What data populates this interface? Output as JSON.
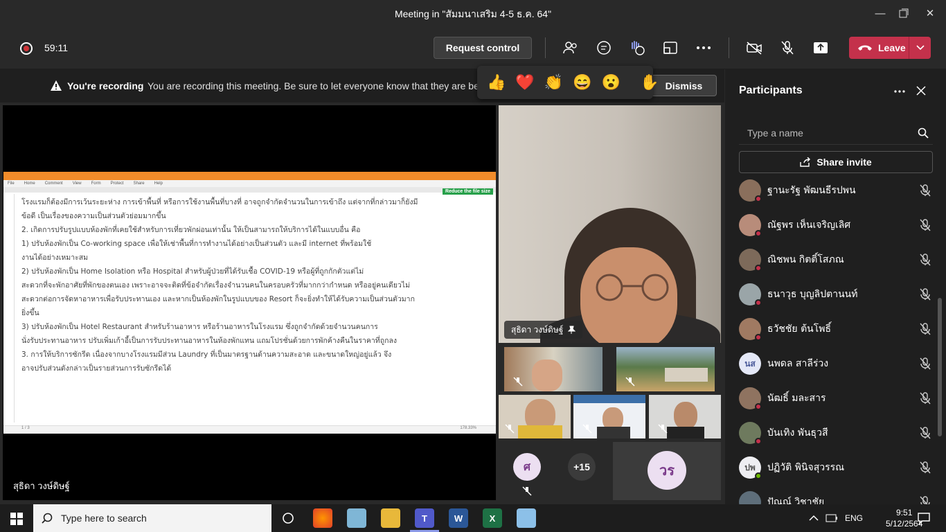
{
  "window": {
    "title": "Meeting in \"สัมมนาเสริม 4-5 ธ.ค. 64\""
  },
  "toolbar": {
    "timer": "59:11",
    "request_control": "Request control",
    "leave": "Leave"
  },
  "banner": {
    "bold": "You're recording",
    "message": "You are recording this meeting. Be sure to let everyone know that they are be",
    "dismiss": "Dismiss"
  },
  "reactions": [
    "👍",
    "❤️",
    "👏",
    "😄",
    "😮",
    "✋"
  ],
  "stage": {
    "presenter_name": "สุธิดา วงษ์ดิษฐ์",
    "document": {
      "menu": [
        "File",
        "Home",
        "Comment",
        "View",
        "Form",
        "Protect",
        "Share",
        "Help"
      ],
      "reduce_label": "Reduce the file size",
      "lines": [
        "โรงแรมก็ต้องมีการเว้นระยะห่าง การเข้าพื้นที่ หรือการใช้งานพื้นที่บางที่ อาจถูกจำกัดจำนวนในการเข้าถึง แต่จากที่กล่าวมาก็ยังมี",
        "ข้อดี เป็นเรื่องของความเป็นส่วนตัวย่อมมากขึ้น",
        "        2.  เกิดการปรับรูปแบบห้องพักที่เคยใช้สำหรับการเที่ยวพักผ่อนเท่านั้น ให้เป็นสามารถให้บริการได้ในแบบอื่น คือ",
        "              1) ปรับห้องพักเป็น Co-working space เพื่อให้เช่าพื้นที่การทำงานได้อย่างเป็นส่วนตัว และมี internet ที่พร้อมใช้",
        "งานได้อย่างเหมาะสม",
        "              2) ปรับห้องพักเป็น Home Isolation หรือ Hospital สำหรับผู้ป่วยที่ได้รับเชื้อ COVID-19 หรือผู้ที่ถูกกักตัวแต่ไม่",
        "สะดวกที่จะพักอาศัยที่พักของตนเอง เพราะอาจจะติดที่ข้อจำกัดเรื่องจำนวนคนในครอบครัวที่มากกว่ากำหนด หรืออยู่คนเดียวไม่",
        "สะดวกต่อการจัดหาอาหารเพื่อรับประทานเอง และหากเป็นห้องพักในรูปแบบของ Resort ก็จะยิ่งทำให้ได้รับความเป็นส่วนตัวมาก",
        "ยิ่งขึ้น",
        "              3) ปรับห้องพักเป็น Hotel Restaurant สำหรับร้านอาหาร หรือร้านอาหารในโรงแรม ซึ่งถูกจำกัดด้วยจำนวนคนการ",
        "นั่งรับประทานอาหาร ปรับเพิ่มเก้าอี้เป็นการรับประทานอาหารในห้องพักแทน แถมโปรชั่นด้วยการพักค้างคืนในราคาที่ถูกลง",
        "        3.  การให้บริการซักรีด เนื่องจากบางโรงแรมมีส่วน Laundry ที่เป็นมาตรฐานด้านความสะอาด และขนาดใหญ่อยู่แล้ว จึง",
        "อาจปรับส่วนดังกล่าวเป็นรายส่วนการรับซักรีดได้"
      ],
      "page_indicator": "1 / 3",
      "zoom": "178.33%"
    }
  },
  "videos": {
    "main_name": "สุธิดา วงษ์ดิษฐ์",
    "avatar_letters": [
      "ศ",
      "วร"
    ],
    "overflow": "+15"
  },
  "participants": {
    "title": "Participants",
    "search_placeholder": "Type a name",
    "share_invite": "Share invite",
    "list": [
      {
        "name": "ฐานะรัฐ พัฒนธีรปพน",
        "initials": ""
      },
      {
        "name": "ณัฐพร เห็นเจริญเลิศ",
        "initials": ""
      },
      {
        "name": "ณิชพน กิตติ์โสภณ",
        "initials": ""
      },
      {
        "name": "ธนาวุธ บุญลิปตานนท์",
        "initials": ""
      },
      {
        "name": "ธวัชชัย ต้นโพธิ์",
        "initials": ""
      },
      {
        "name": "นพดล สาลีร่วง",
        "initials": "นส"
      },
      {
        "name": "นัฒธิ์ มละสาร",
        "initials": ""
      },
      {
        "name": "บันเทิง พันธุวสี",
        "initials": ""
      },
      {
        "name": "ปฏิวัติ พินิจสุวรรณ",
        "initials": "ปพ"
      },
      {
        "name": "ปัณณ์ วิชาชัย",
        "initials": ""
      }
    ]
  },
  "taskbar": {
    "search_placeholder": "Type here to search",
    "lang": "ENG",
    "time": "9:51",
    "date": "5/12/2564"
  }
}
